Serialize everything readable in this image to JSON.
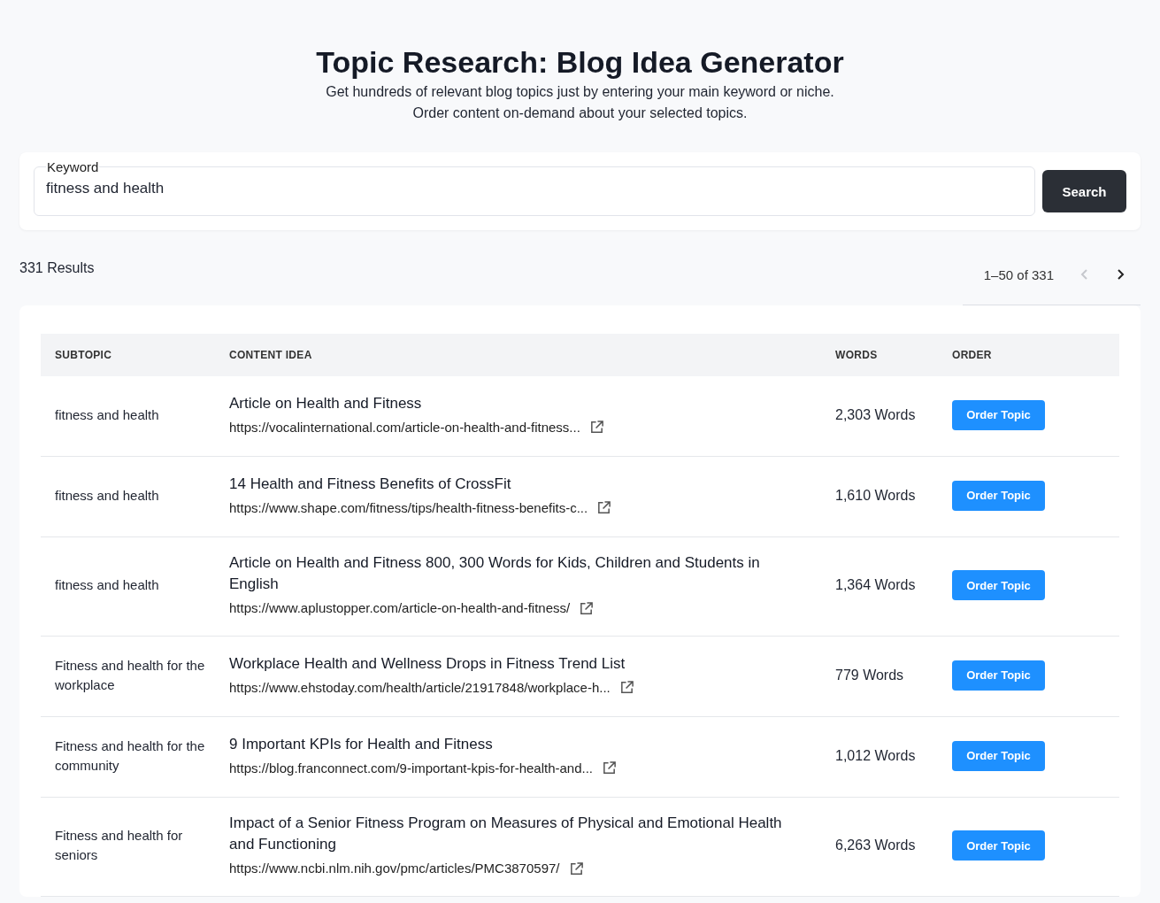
{
  "header": {
    "title": "Topic Research: Blog Idea Generator",
    "subtitle_lines": [
      "Get hundreds of relevant blog topics just by entering your main keyword or niche.",
      "Order content on-demand about your selected topics."
    ]
  },
  "search": {
    "label": "Keyword",
    "value": "fitness and health",
    "button": "Search"
  },
  "results": {
    "count": "331 Results",
    "range": "1–50 of 331",
    "prev_disabled": true,
    "next_disabled": false
  },
  "table": {
    "columns": [
      "SUBTOPIC",
      "CONTENT IDEA",
      "WORDS",
      "ORDER"
    ],
    "rows": [
      {
        "subtopic": "fitness and health",
        "title": "Article on Health and Fitness",
        "url": "https://vocalinternational.com/article-on-health-and-fitness...",
        "words": "2,303 Words",
        "button": "Order Topic"
      },
      {
        "subtopic": "fitness and health",
        "title": "14 Health and Fitness Benefits of CrossFit",
        "url": "https://www.shape.com/fitness/tips/health-fitness-benefits-c...",
        "words": "1,610 Words",
        "button": "Order Topic"
      },
      {
        "subtopic": "fitness and health",
        "title": "Article on Health and Fitness 800, 300 Words for Kids, Children and Students in English",
        "url": "https://www.aplustopper.com/article-on-health-and-fitness/",
        "words": "1,364 Words",
        "button": "Order Topic"
      },
      {
        "subtopic": "Fitness and health for the workplace",
        "title": "Workplace Health and Wellness Drops in Fitness Trend List",
        "url": "https://www.ehstoday.com/health/article/21917848/workplace-h...",
        "words": "779 Words",
        "button": "Order Topic"
      },
      {
        "subtopic": "Fitness and health for the community",
        "title": "9 Important KPIs for Health and Fitness",
        "url": "https://blog.franconnect.com/9-important-kpis-for-health-and...",
        "words": "1,012 Words",
        "button": "Order Topic"
      },
      {
        "subtopic": "Fitness and health for seniors",
        "title": "Impact of a Senior Fitness Program on Measures of Physical and Emotional Health and Functioning",
        "url": "https://www.ncbi.nlm.nih.gov/pmc/articles/PMC3870597/",
        "words": "6,263 Words",
        "button": "Order Topic"
      }
    ]
  }
}
